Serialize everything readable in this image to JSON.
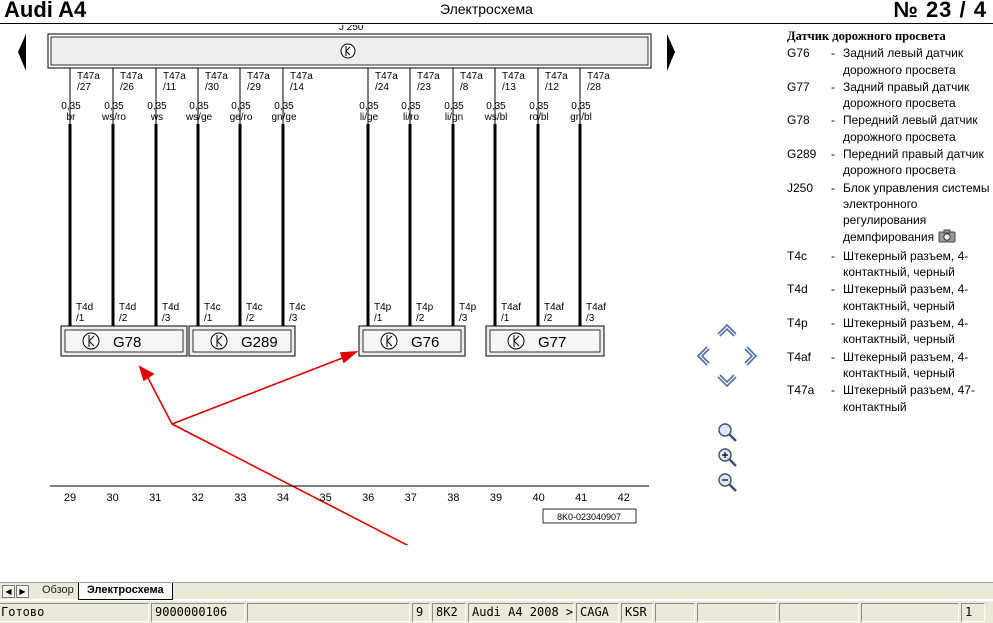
{
  "header": {
    "title": "Audi A4",
    "diagram_type": "Электросхема",
    "page_number": "№  23 / 4"
  },
  "diagram": {
    "module_label_partial": "J 250",
    "connectors": [
      {
        "top": "T47a",
        "pin": "/27",
        "gauge": "0,35",
        "color": "br",
        "bottom": "T4d",
        "bottom_pin": "/1"
      },
      {
        "top": "T47a",
        "pin": "/26",
        "gauge": "0,35",
        "color": "ws/ro",
        "bottom": "T4d",
        "bottom_pin": "/2"
      },
      {
        "top": "T47a",
        "pin": "/11",
        "gauge": "0,35",
        "color": "ws",
        "bottom": "T4d",
        "bottom_pin": "/3"
      },
      {
        "top": "T47a",
        "pin": "/30",
        "gauge": "0,35",
        "color": "ws/ge",
        "bottom": "T4c",
        "bottom_pin": "/1"
      },
      {
        "top": "T47a",
        "pin": "/29",
        "gauge": "0,35",
        "color": "ge/ro",
        "bottom": "T4c",
        "bottom_pin": "/2"
      },
      {
        "top": "T47a",
        "pin": "/14",
        "gauge": "0,35",
        "color": "gn/ge",
        "bottom": "T4c",
        "bottom_pin": "/3"
      },
      {
        "top": "T47a",
        "pin": "/24",
        "gauge": "0,35",
        "color": "li/ge",
        "bottom": "T4p",
        "bottom_pin": "/1"
      },
      {
        "top": "T47a",
        "pin": "/23",
        "gauge": "0,35",
        "color": "li/ro",
        "bottom": "T4p",
        "bottom_pin": "/2"
      },
      {
        "top": "T47a",
        "pin": "/8",
        "gauge": "0,35",
        "color": "li/gn",
        "bottom": "T4p",
        "bottom_pin": "/3"
      },
      {
        "top": "T47a",
        "pin": "/13",
        "gauge": "0,35",
        "color": "ws/bl",
        "bottom": "T4af",
        "bottom_pin": "/1"
      },
      {
        "top": "T47a",
        "pin": "/12",
        "gauge": "0,35",
        "color": "ro/bl",
        "bottom": "T4af",
        "bottom_pin": "/2"
      },
      {
        "top": "T47a",
        "pin": "/28",
        "gauge": "0,35",
        "color": "gn/bl",
        "bottom": "T4af",
        "bottom_pin": "/3"
      }
    ],
    "components": [
      "G78",
      "G289",
      "G76",
      "G77"
    ],
    "ruler": [
      "29",
      "30",
      "31",
      "32",
      "33",
      "34",
      "35",
      "36",
      "37",
      "38",
      "39",
      "40",
      "41",
      "42"
    ],
    "part_number": "8K0-023040907",
    "nav_icons": [
      "arrow-up-icon",
      "arrow-left-icon",
      "arrow-right-icon",
      "arrow-down-icon"
    ],
    "zoom_icons": [
      "zoom-window-icon",
      "zoom-in-icon",
      "zoom-out-icon"
    ],
    "accent_color": "#e00000"
  },
  "legend": {
    "title": "Датчик дорожного просвета",
    "items": [
      {
        "code": "G76",
        "desc": "Задний левый датчик дорожного просвета"
      },
      {
        "code": "G77",
        "desc": "Задний правый датчик дорожного просвета"
      },
      {
        "code": "G78",
        "desc": "Передний левый датчик дорожного просвета"
      },
      {
        "code": "G289",
        "desc": "Передний правый датчик дорожного просвета"
      },
      {
        "code": "J250",
        "desc": "Блок управления системы электронного регулирования демпфирования"
      },
      {
        "code": "T4c",
        "desc": "Штекерный разъем, 4-контактный, черный"
      },
      {
        "code": "T4d",
        "desc": "Штекерный разъем, 4-контактный, черный"
      },
      {
        "code": "T4p",
        "desc": "Штекерный разъем, 4-контактный, черный"
      },
      {
        "code": "T4af",
        "desc": "Штекерный разъем, 4-контактный, черный"
      },
      {
        "code": "T47a",
        "desc": "Штекерный разъем, 47-контактный"
      }
    ]
  },
  "tabs": [
    {
      "label": "Обзор"
    },
    {
      "label": "Электросхема"
    }
  ],
  "status": {
    "state": "Готово",
    "code": "9000000106",
    "field1": "9",
    "field2": "8K2",
    "model": "Audi A4 2008 >",
    "engine": "CAGA",
    "gearbox": "KSR",
    "page": "1"
  }
}
